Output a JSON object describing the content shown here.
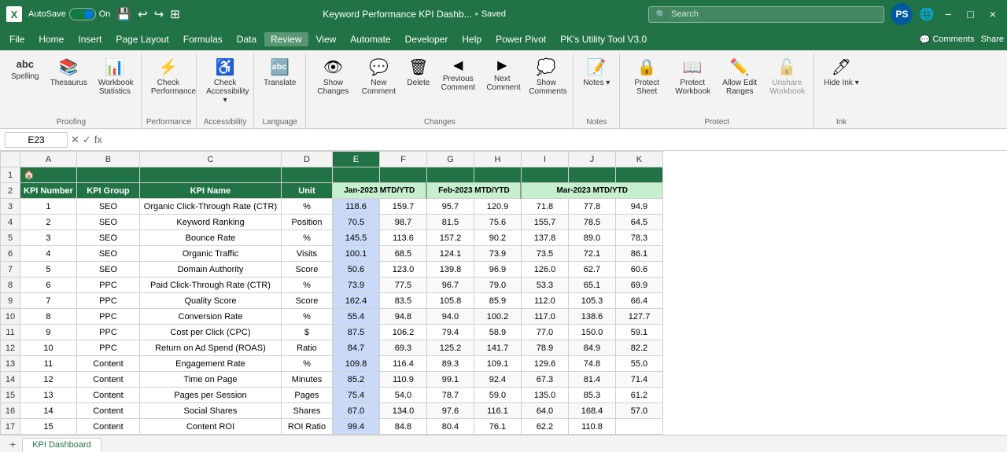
{
  "titleBar": {
    "excelIcon": "X",
    "autosave": "AutoSave",
    "toggleOn": "On",
    "title": "Keyword Performance KPI Dashb...",
    "saved": "Saved",
    "search": "Search",
    "avatar": "PS",
    "minimize": "−",
    "maximize": "□",
    "close": "×"
  },
  "menuBar": {
    "items": [
      "File",
      "Home",
      "Insert",
      "Page Layout",
      "Formulas",
      "Data",
      "Review",
      "View",
      "Automate",
      "Developer",
      "Help",
      "Power Pivot",
      "PK's Utility Tool V3.0"
    ]
  },
  "ribbon": {
    "groups": [
      {
        "label": "Proofing",
        "buttons": [
          {
            "icon": "abc",
            "label": "Spelling"
          },
          {
            "icon": "📚",
            "label": "Thesaurus"
          },
          {
            "icon": "📊",
            "label": "Workbook Statistics"
          }
        ]
      },
      {
        "label": "Performance",
        "buttons": [
          {
            "icon": "✓",
            "label": "Check Performance"
          }
        ]
      },
      {
        "label": "Accessibility",
        "buttons": [
          {
            "icon": "♿",
            "label": "Check Accessibility"
          }
        ]
      },
      {
        "label": "Language",
        "buttons": [
          {
            "icon": "🔤",
            "label": "Translate"
          }
        ]
      },
      {
        "label": "Changes",
        "buttons": [
          {
            "icon": "👁",
            "label": "Show Changes"
          },
          {
            "icon": "💬",
            "label": "New Comment"
          },
          {
            "icon": "🗑",
            "label": "Delete"
          },
          {
            "icon": "◀",
            "label": "Previous Comment"
          },
          {
            "icon": "▶",
            "label": "Next Comment"
          },
          {
            "icon": "💬",
            "label": "Show Comments"
          }
        ]
      },
      {
        "label": "Notes",
        "buttons": [
          {
            "icon": "📝",
            "label": "Notes"
          }
        ]
      },
      {
        "label": "Protect",
        "buttons": [
          {
            "icon": "🔒",
            "label": "Protect Sheet"
          },
          {
            "icon": "📖",
            "label": "Protect Workbook"
          },
          {
            "icon": "✏️",
            "label": "Allow Edit Ranges"
          },
          {
            "icon": "🔓",
            "label": "Unshare Workbook"
          }
        ]
      },
      {
        "label": "Ink",
        "buttons": [
          {
            "icon": "🖊",
            "label": "Hide Ink"
          }
        ]
      }
    ]
  },
  "formulaBar": {
    "cellRef": "E23",
    "formula": ""
  },
  "columns": {
    "headers": [
      "",
      "A",
      "B",
      "C",
      "D",
      "E",
      "F",
      "G",
      "H",
      "I",
      "J",
      "K"
    ],
    "widths": [
      25,
      80,
      100,
      200,
      70,
      70,
      70,
      70,
      70,
      70,
      70,
      70
    ]
  },
  "rows": {
    "row1": {
      "num": 1,
      "data": [
        "",
        "",
        "",
        "",
        "",
        "",
        "",
        "",
        "",
        "",
        "",
        ""
      ]
    },
    "row2": {
      "num": 2,
      "data": [
        "",
        "KPI Number",
        "KPI Group",
        "KPI Name",
        "Unit",
        "MTD",
        "YTD",
        "MTD",
        "YTD",
        "MTD",
        "YTD",
        "MTD"
      ]
    },
    "monthRow": {
      "jan": "Jan-2023",
      "feb": "Feb-2023",
      "mar": "Mar-2023"
    },
    "dataRows": [
      {
        "num": 3,
        "kpiNum": "1",
        "group": "SEO",
        "name": "Organic Click-Through Rate (CTR)",
        "unit": "%",
        "e": "118.6",
        "f": "159.7",
        "g": "95.7",
        "h": "120.9",
        "i": "71.8",
        "j": "77.8",
        "k": "94.9"
      },
      {
        "num": 4,
        "kpiNum": "2",
        "group": "SEO",
        "name": "Keyword Ranking",
        "unit": "Position",
        "e": "70.5",
        "f": "98.7",
        "g": "81.5",
        "h": "75.6",
        "i": "155.7",
        "j": "78.5",
        "k": "64.5"
      },
      {
        "num": 5,
        "kpiNum": "3",
        "group": "SEO",
        "name": "Bounce Rate",
        "unit": "%",
        "e": "145.5",
        "f": "113.6",
        "g": "157.2",
        "h": "90.2",
        "i": "137.8",
        "j": "89.0",
        "k": "78.3"
      },
      {
        "num": 6,
        "kpiNum": "4",
        "group": "SEO",
        "name": "Organic Traffic",
        "unit": "Visits",
        "e": "100.1",
        "f": "68.5",
        "g": "124.1",
        "h": "73.9",
        "i": "73.5",
        "j": "72.1",
        "k": "86.1"
      },
      {
        "num": 7,
        "kpiNum": "5",
        "group": "SEO",
        "name": "Domain Authority",
        "unit": "Score",
        "e": "50.6",
        "f": "123.0",
        "g": "139.8",
        "h": "96.9",
        "i": "126.0",
        "j": "62.7",
        "k": "60.6"
      },
      {
        "num": 8,
        "kpiNum": "6",
        "group": "PPC",
        "name": "Paid Click-Through Rate (CTR)",
        "unit": "%",
        "e": "73.9",
        "f": "77.5",
        "g": "96.7",
        "h": "79.0",
        "i": "53.3",
        "j": "65.1",
        "k": "69.9"
      },
      {
        "num": 9,
        "kpiNum": "7",
        "group": "PPC",
        "name": "Quality Score",
        "unit": "Score",
        "e": "162.4",
        "f": "83.5",
        "g": "105.8",
        "h": "85.9",
        "i": "112.0",
        "j": "105.3",
        "k": "66.4"
      },
      {
        "num": 10,
        "kpiNum": "8",
        "group": "PPC",
        "name": "Conversion Rate",
        "unit": "%",
        "e": "55.4",
        "f": "94.8",
        "g": "94.0",
        "h": "100.2",
        "i": "117.0",
        "j": "138.6",
        "k": "127.7"
      },
      {
        "num": 11,
        "kpiNum": "9",
        "group": "PPC",
        "name": "Cost per Click (CPC)",
        "unit": "$",
        "e": "87.5",
        "f": "106.2",
        "g": "79.4",
        "h": "58.9",
        "i": "77.0",
        "j": "150.0",
        "k": "59.1"
      },
      {
        "num": 12,
        "kpiNum": "10",
        "group": "PPC",
        "name": "Return on Ad Spend (ROAS)",
        "unit": "Ratio",
        "e": "84.7",
        "f": "69.3",
        "g": "125.2",
        "h": "141.7",
        "i": "78.9",
        "j": "84.9",
        "k": "82.2"
      },
      {
        "num": 13,
        "kpiNum": "11",
        "group": "Content",
        "name": "Engagement Rate",
        "unit": "%",
        "e": "109.8",
        "f": "116.4",
        "g": "89.3",
        "h": "109.1",
        "i": "129.6",
        "j": "74.8",
        "k": "55.0"
      },
      {
        "num": 14,
        "kpiNum": "12",
        "group": "Content",
        "name": "Time on Page",
        "unit": "Minutes",
        "e": "85.2",
        "f": "110.9",
        "g": "99.1",
        "h": "92.4",
        "i": "67.3",
        "j": "81.4",
        "k": "71.4"
      },
      {
        "num": 15,
        "kpiNum": "13",
        "group": "Content",
        "name": "Pages per Session",
        "unit": "Pages",
        "e": "75.4",
        "f": "54.0",
        "g": "78.7",
        "h": "59.0",
        "i": "135.0",
        "j": "85.3",
        "k": "61.2"
      },
      {
        "num": 16,
        "kpiNum": "14",
        "group": "Content",
        "name": "Social Shares",
        "unit": "Shares",
        "e": "67.0",
        "f": "134.0",
        "g": "97.6",
        "h": "116.1",
        "i": "64.0",
        "j": "168.4",
        "k": "57.0"
      },
      {
        "num": 17,
        "kpiNum": "15",
        "group": "Content",
        "name": "Content ROI",
        "unit": "ROI Ratio",
        "e": "99.4",
        "f": "84.8",
        "g": "80.4",
        "h": "76.1",
        "i": "62.2",
        "j": "110.8",
        "k": ""
      }
    ]
  },
  "sheetTabs": [
    "KPI Dashboard"
  ]
}
